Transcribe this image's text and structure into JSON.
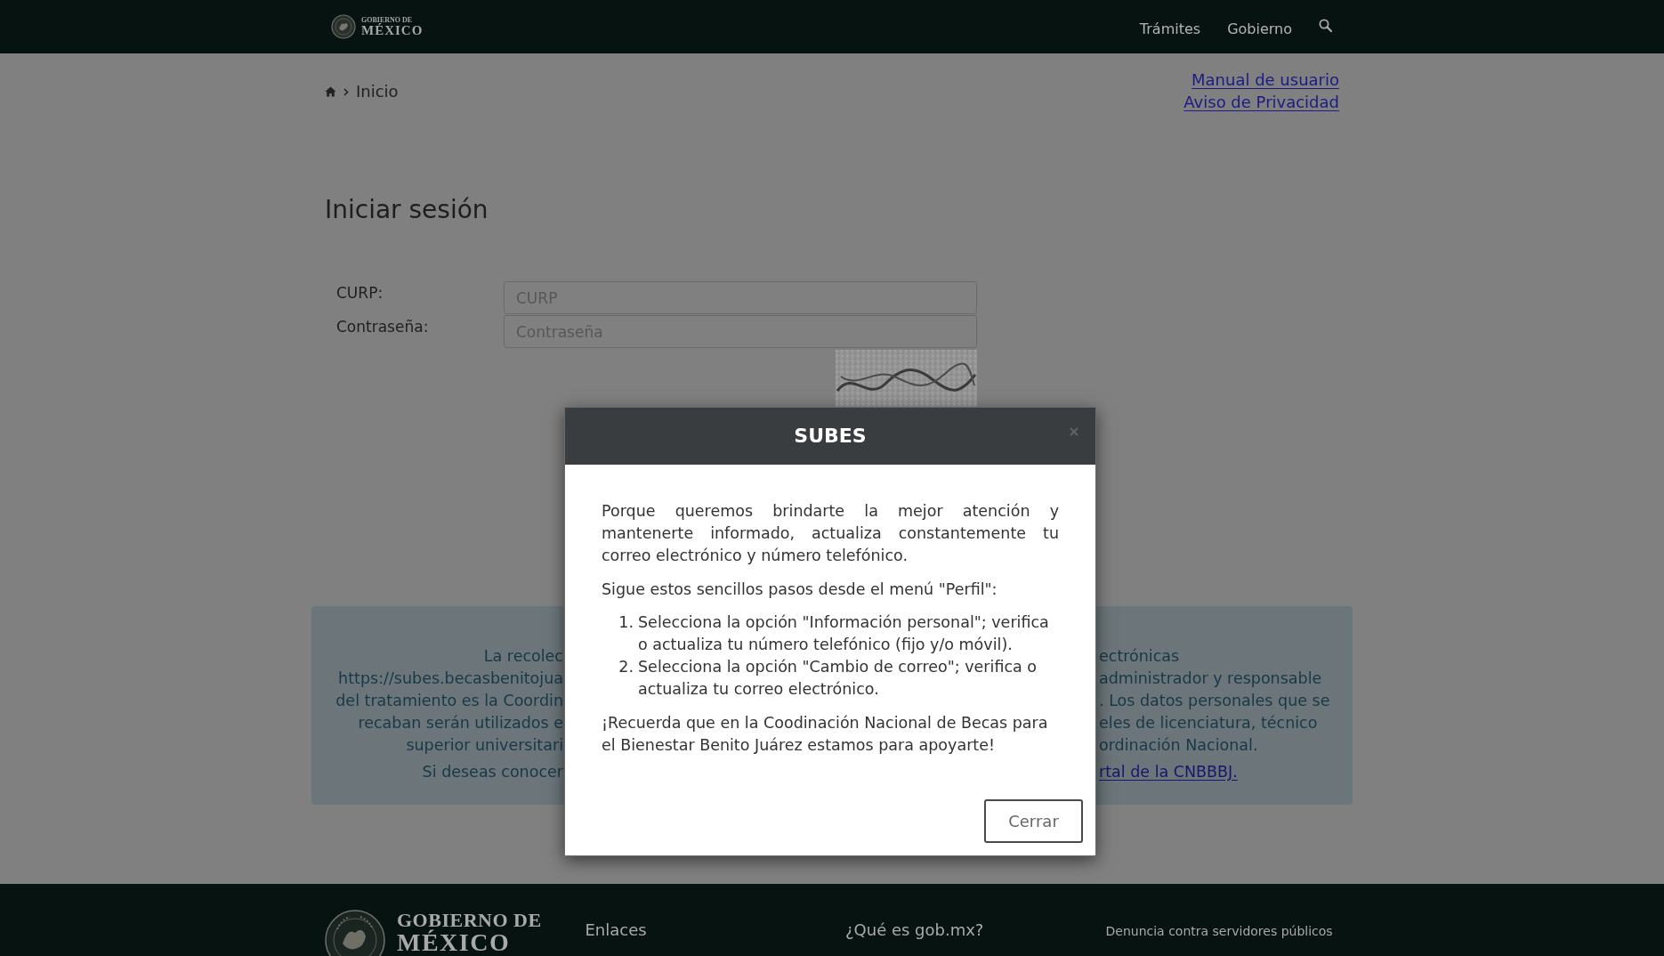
{
  "header": {
    "logo_top": "GOBIERNO DE",
    "logo_bottom": "MÉXICO",
    "nav": [
      "Trámites",
      "Gobierno"
    ]
  },
  "breadcrumb": {
    "current": "Inicio"
  },
  "top_links": [
    "Manual de usuario",
    "Aviso de Privacidad"
  ],
  "login": {
    "title": "Iniciar sesión",
    "fields": [
      {
        "label": "CURP:",
        "placeholder": "CURP"
      },
      {
        "label": "Contraseña:",
        "placeholder": "Contraseña"
      }
    ]
  },
  "privacy_notice": {
    "paragraphs": [
      {
        "lines": [
          {
            "left": "La recolec",
            "right": "ectrónicas",
            "right_link": false
          },
          {
            "left": "https://subes.becasbenitojua",
            "right": "administrador y responsable",
            "right_link": false
          },
          {
            "left": "del tratamiento es la Coordin",
            "right": ". Los datos personales que se",
            "right_link": false
          },
          {
            "left": "recaban serán utilizados e",
            "right": "eles de licenciatura, técnico",
            "right_link": false
          },
          {
            "left": "superior universitari",
            "right": "ordinación Nacional.",
            "right_link": false
          }
        ]
      },
      {
        "lines": [
          {
            "left": "Si deseas conocer",
            "right": "rtal de la CNBBBJ.",
            "right_link": true
          }
        ]
      }
    ]
  },
  "modal": {
    "title": "SUBES",
    "intro": "Porque queremos brindarte la mejor atención y mantenerte informado, actualiza constantemente tu correo electrónico y número telefónico.",
    "steps_heading": "Sigue estos sencillos pasos desde el menú \"Perfil\":",
    "steps": [
      {
        "number": "1.",
        "text": "Selecciona la opción \"Información personal\"; verifica o actualiza tu número telefónico (fijo y/o móvil)."
      },
      {
        "number": "2.",
        "text": "Selecciona la opción \"Cambio de correo\"; verifica o actualiza tu correo electrónico."
      }
    ],
    "closing": "¡Recuerda que en la Coodinación Nacional de Becas para el Bienestar Benito Juárez estamos para apoyarte!",
    "button": "Cerrar"
  },
  "footer": {
    "logo_top": "GOBIERNO DE",
    "logo_bottom": "MÉXICO",
    "links_heading": "Enlaces",
    "about_heading": "¿Qué es gob.mx?",
    "complaint": "Denuncia contra servidores públicos"
  }
}
